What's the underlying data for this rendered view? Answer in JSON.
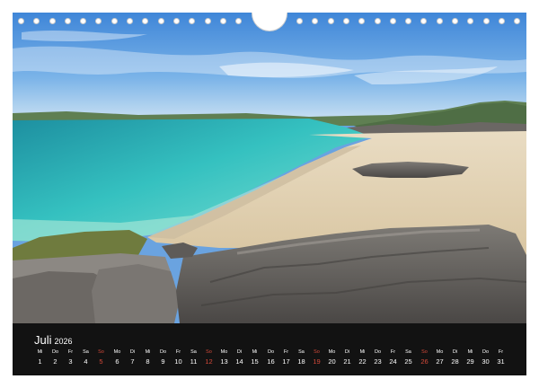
{
  "calendar": {
    "month": "Juli",
    "year": "2026",
    "days": [
      {
        "wd": "Mi",
        "d": "1"
      },
      {
        "wd": "Do",
        "d": "2"
      },
      {
        "wd": "Fr",
        "d": "3"
      },
      {
        "wd": "Sa",
        "d": "4"
      },
      {
        "wd": "So",
        "d": "5"
      },
      {
        "wd": "Mo",
        "d": "6"
      },
      {
        "wd": "Di",
        "d": "7"
      },
      {
        "wd": "Mi",
        "d": "8"
      },
      {
        "wd": "Do",
        "d": "9"
      },
      {
        "wd": "Fr",
        "d": "10"
      },
      {
        "wd": "Sa",
        "d": "11"
      },
      {
        "wd": "So",
        "d": "12"
      },
      {
        "wd": "Mo",
        "d": "13"
      },
      {
        "wd": "Di",
        "d": "14"
      },
      {
        "wd": "Mi",
        "d": "15"
      },
      {
        "wd": "Do",
        "d": "16"
      },
      {
        "wd": "Fr",
        "d": "17"
      },
      {
        "wd": "Sa",
        "d": "18"
      },
      {
        "wd": "So",
        "d": "19"
      },
      {
        "wd": "Mo",
        "d": "20"
      },
      {
        "wd": "Di",
        "d": "21"
      },
      {
        "wd": "Mi",
        "d": "22"
      },
      {
        "wd": "Do",
        "d": "23"
      },
      {
        "wd": "Fr",
        "d": "24"
      },
      {
        "wd": "Sa",
        "d": "25"
      },
      {
        "wd": "So",
        "d": "26"
      },
      {
        "wd": "Mo",
        "d": "27"
      },
      {
        "wd": "Di",
        "d": "28"
      },
      {
        "wd": "Mi",
        "d": "29"
      },
      {
        "wd": "Do",
        "d": "30"
      },
      {
        "wd": "Fr",
        "d": "31"
      }
    ]
  },
  "colors": {
    "sunday": "#d64a3a",
    "calendar_bg": "#121212",
    "sea_turquoise": "#3fc7c0",
    "sky": "#5b9be0"
  }
}
